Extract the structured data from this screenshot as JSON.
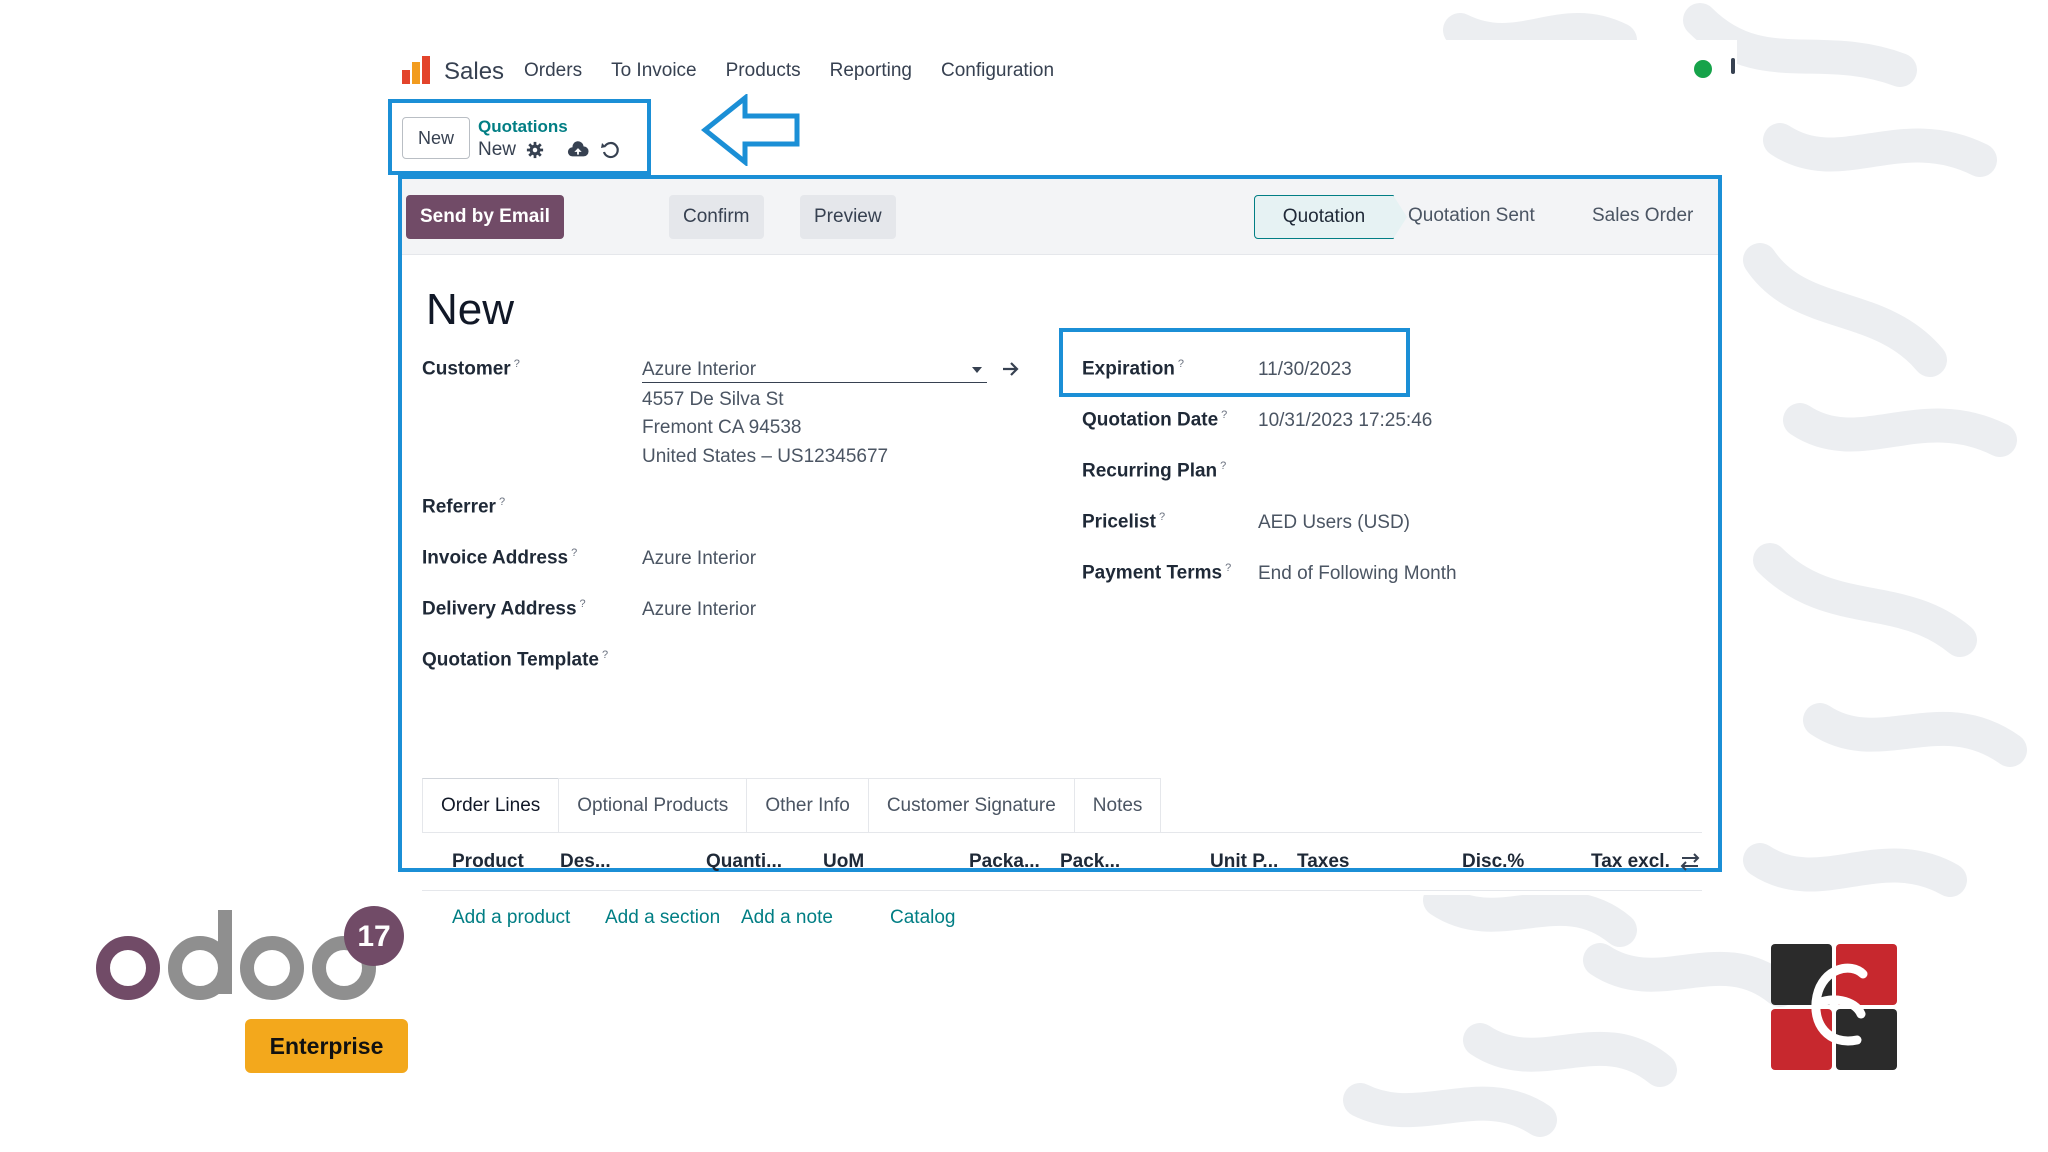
{
  "app": {
    "name": "Sales",
    "menu": [
      "Orders",
      "To Invoice",
      "Products",
      "Reporting",
      "Configuration"
    ]
  },
  "control_panel": {
    "new_button": "New",
    "breadcrumb_parent": "Quotations",
    "breadcrumb_current": "New",
    "icons": [
      "gear-icon",
      "cloud-upload-icon",
      "discard-icon"
    ]
  },
  "statusbar": {
    "buttons": [
      "Send by Email",
      "Confirm",
      "Preview"
    ],
    "stages": [
      "Quotation",
      "Quotation Sent",
      "Sales Order"
    ],
    "active_stage": "Quotation"
  },
  "form": {
    "title": "New",
    "customer_label": "Customer",
    "customer_value": "Azure Interior",
    "customer_address": [
      "4557 De Silva St",
      "Fremont CA 94538",
      "United States – US12345677"
    ],
    "referrer_label": "Referrer",
    "invoice_address_label": "Invoice Address",
    "invoice_address_value": "Azure Interior",
    "delivery_address_label": "Delivery Address",
    "delivery_address_value": "Azure Interior",
    "quotation_template_label": "Quotation Template",
    "expiration_label": "Expiration",
    "expiration_value": "11/30/2023",
    "quotation_date_label": "Quotation Date",
    "quotation_date_value": "10/31/2023 17:25:46",
    "recurring_plan_label": "Recurring Plan",
    "pricelist_label": "Pricelist",
    "pricelist_value": "AED Users (USD)",
    "payment_terms_label": "Payment Terms",
    "payment_terms_value": "End of Following Month",
    "help_mark": "?"
  },
  "tabs": [
    "Order Lines",
    "Optional Products",
    "Other Info",
    "Customer Signature",
    "Notes"
  ],
  "order_lines": {
    "columns": [
      "Product",
      "Des...",
      "Quanti...",
      "UoM",
      "Packa...",
      "Pack...",
      "Unit P...",
      "Taxes",
      "Disc.%",
      "Tax excl."
    ],
    "actions": [
      "Add a product",
      "Add a section",
      "Add a note",
      "Catalog"
    ]
  },
  "branding": {
    "odoo_version": "17",
    "edition": "Enterprise",
    "accent": "#714b67",
    "highlight": "#1b8fd6"
  }
}
